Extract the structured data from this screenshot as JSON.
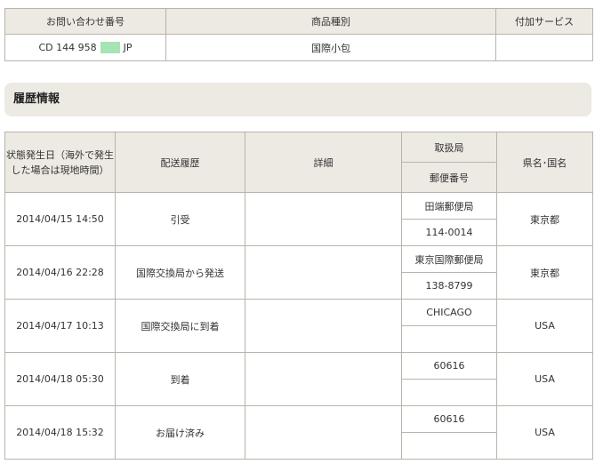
{
  "summary": {
    "headers": [
      "お問い合わせ番号",
      "商品種別",
      "付加サービス"
    ],
    "tracking_prefix": "CD 144 958",
    "tracking_suffix": "JP",
    "product_type": "国際小包",
    "additional_service": ""
  },
  "section_title": "履歴情報",
  "history": {
    "headers": {
      "date": "状態発生日（海外で発生した場合は現地時間）",
      "status": "配送履歴",
      "detail": "詳細",
      "office": "取扱局",
      "postal": "郵便番号",
      "region": "県名･国名"
    },
    "rows": [
      {
        "date": "2014/04/15 14:50",
        "status": "引受",
        "detail": "",
        "office": "田端郵便局",
        "postal": "114-0014",
        "region": "東京都"
      },
      {
        "date": "2014/04/16 22:28",
        "status": "国際交換局から発送",
        "detail": "",
        "office": "東京国際郵便局",
        "postal": "138-8799",
        "region": "東京都"
      },
      {
        "date": "2014/04/17 10:13",
        "status": "国際交換局に到着",
        "detail": "",
        "office": "CHICAGO",
        "postal": "",
        "region": "USA"
      },
      {
        "date": "2014/04/18 05:30",
        "status": "到着",
        "detail": "",
        "office": "60616",
        "postal": "",
        "region": "USA"
      },
      {
        "date": "2014/04/18 15:32",
        "status": "お届け済み",
        "detail": "",
        "office": "60616",
        "postal": "",
        "region": "USA"
      }
    ]
  }
}
